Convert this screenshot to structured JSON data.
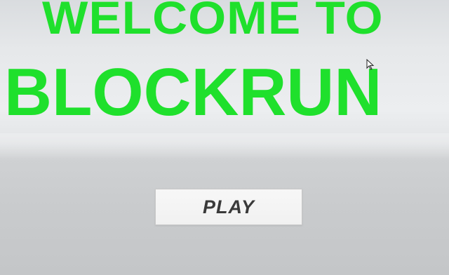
{
  "title": {
    "line1": "WELCOME TO",
    "line2": "BLOCKRUN",
    "color": "#1fe02c"
  },
  "play_button": {
    "label": "PLAY"
  },
  "cursor": {
    "icon": "arrow-cursor-icon"
  }
}
